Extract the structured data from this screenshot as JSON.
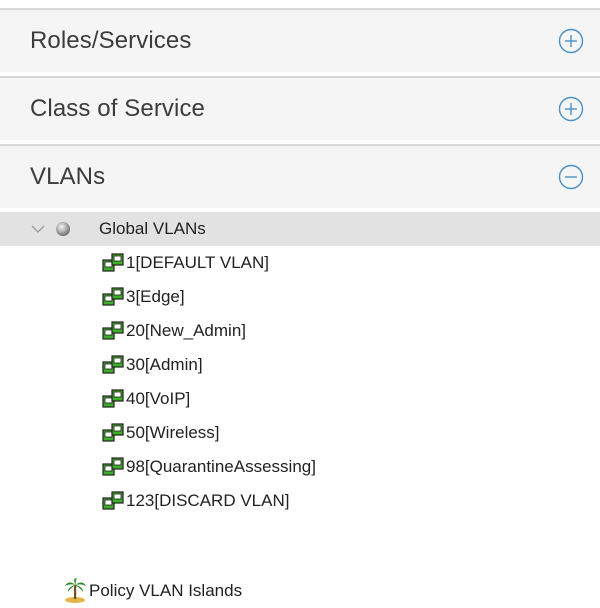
{
  "accordion": {
    "roles_services": {
      "label": "Roles/Services",
      "state": "collapsed",
      "toggle_icon": "plus-circle-icon"
    },
    "class_of_service": {
      "label": "Class of Service",
      "state": "collapsed",
      "toggle_icon": "plus-circle-icon"
    },
    "vlans": {
      "label": "VLANs",
      "state": "expanded",
      "toggle_icon": "minus-circle-icon"
    }
  },
  "tree": {
    "global_vlans": {
      "label": "Global VLANs",
      "expanded": true,
      "selected": true,
      "icon": "gray-sphere-icon"
    },
    "vlan_items": [
      {
        "label": "1[DEFAULT VLAN]",
        "icon": "vlan-network-icon"
      },
      {
        "label": "3[Edge]",
        "icon": "vlan-network-icon"
      },
      {
        "label": "20[New_Admin]",
        "icon": "vlan-network-icon"
      },
      {
        "label": "30[Admin]",
        "icon": "vlan-network-icon"
      },
      {
        "label": "40[VoIP]",
        "icon": "vlan-network-icon"
      },
      {
        "label": "50[Wireless]",
        "icon": "vlan-network-icon"
      },
      {
        "label": "98[QuarantineAssessing]",
        "icon": "vlan-network-icon"
      },
      {
        "label": "123[DISCARD VLAN]",
        "icon": "vlan-network-icon"
      }
    ],
    "policy_vlan_islands": {
      "label": "Policy VLAN Islands",
      "icon": "palm-tree-island-icon"
    }
  },
  "colors": {
    "header_bg": "#f5f5f5",
    "header_border": "#d8d8d8",
    "toggle_blue": "#4a90c8",
    "selected_row_bg": "#e2e2e2",
    "vlan_icon_green": "#3fae2a"
  }
}
